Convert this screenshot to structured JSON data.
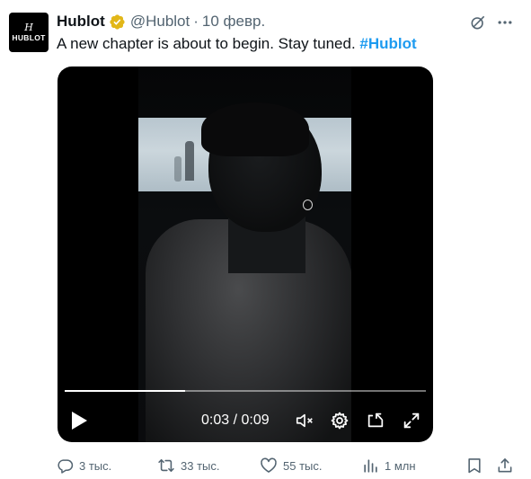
{
  "author": {
    "name": "Hublot",
    "handle": "@Hublot",
    "separator": "·",
    "date": "10 февр.",
    "avatar_mark": "H",
    "avatar_word": "HUBLOT"
  },
  "tweet": {
    "text": "A new chapter is about to begin. Stay tuned.",
    "hashtag": "#Hublot"
  },
  "video": {
    "current_time": "0:03",
    "duration": "0:09",
    "time_display": "0:03 / 0:09",
    "progress_fraction": 0.3333
  },
  "actions": {
    "replies": "3 тыс.",
    "retweets": "33 тыс.",
    "likes": "55 тыс.",
    "views": "1 млн"
  },
  "colors": {
    "accent": "#1d9bf0",
    "verified": "#e2b719",
    "secondary_text": "#536471"
  },
  "icons": [
    "verified-badge-icon",
    "grok-icon",
    "more-icon",
    "play-icon",
    "mute-icon",
    "settings-icon",
    "pip-icon",
    "fullscreen-icon",
    "reply-icon",
    "retweet-icon",
    "like-icon",
    "views-icon",
    "bookmark-icon",
    "share-icon"
  ]
}
